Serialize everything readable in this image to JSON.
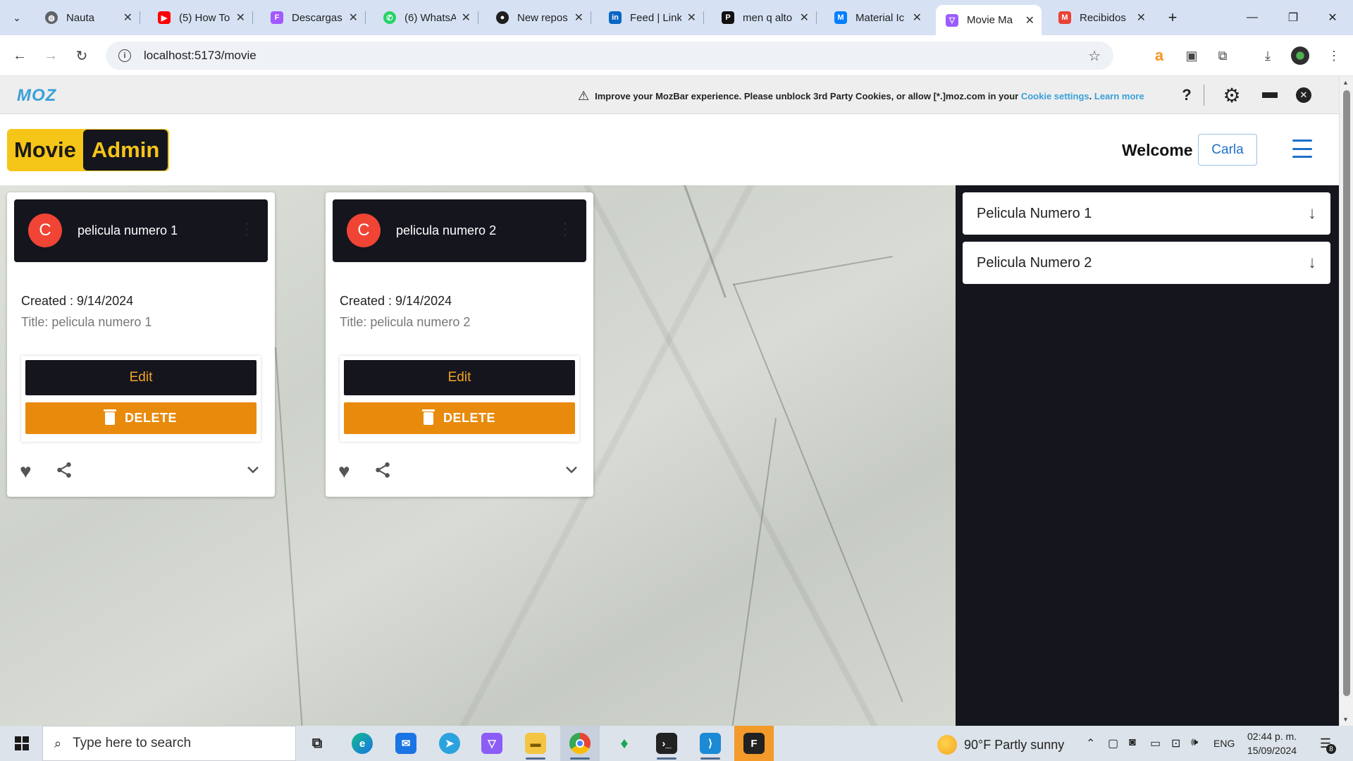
{
  "browser": {
    "tabs": [
      {
        "label": "Nauta",
        "icon": "globe-icon",
        "color": "#5f6368"
      },
      {
        "label": "(5) How To",
        "icon": "youtube-icon",
        "color": "#ff0000"
      },
      {
        "label": "Descargas",
        "icon": "figma-icon",
        "color": "#a259ff"
      },
      {
        "label": "(6) WhatsA",
        "icon": "whatsapp-icon",
        "color": "#25d366"
      },
      {
        "label": "New repos",
        "icon": "github-icon",
        "color": "#1f1f1f"
      },
      {
        "label": "Feed | Link",
        "icon": "linkedin-icon",
        "color": "#0a66c2"
      },
      {
        "label": "men q alto",
        "icon": "p-icon",
        "color": "#111111"
      },
      {
        "label": "Material Ic",
        "icon": "mui-icon",
        "color": "#007fff"
      },
      {
        "label": "Movie Ma",
        "icon": "vite-icon",
        "color": "#9b5cff",
        "active": true
      },
      {
        "label": "Recibidos",
        "icon": "gmail-icon",
        "color": "#ea4335"
      }
    ],
    "url": "localhost:5173/movie"
  },
  "mozbar": {
    "logo": "MOZ",
    "message": "Improve your MozBar experience. Please unblock 3rd Party Cookies, or allow [*.]moz.com in your",
    "cookie_link": "Cookie settings",
    "dot": ".",
    "learn_more": "Learn more",
    "help": "?"
  },
  "header": {
    "logo_part1": "Movie",
    "logo_part2": "Admin",
    "welcome": "Welcome",
    "user": "Carla"
  },
  "cards": [
    {
      "avatar": "C",
      "title": "pelicula numero 1",
      "created": "Created : 9/14/2024",
      "title_line": "Title: pelicula numero 1",
      "edit": "Edit",
      "delete": "DELETE"
    },
    {
      "avatar": "C",
      "title": "pelicula numero 2",
      "created": "Created : 9/14/2024",
      "title_line": "Title: pelicula numero 2",
      "edit": "Edit",
      "delete": "DELETE"
    }
  ],
  "sidebar": {
    "items": [
      {
        "label": "Pelicula Numero 1"
      },
      {
        "label": "Pelicula Numero 2"
      }
    ]
  },
  "taskbar": {
    "search_placeholder": "Type here to search",
    "weather_temp": "90°F",
    "weather_text": "Partly sunny",
    "language": "ENG",
    "time": "02:44 p. m.",
    "date": "15/09/2024",
    "notifications": "8"
  },
  "colors": {
    "brand_yellow": "#f5c518",
    "dark": "#15151e",
    "delete_orange": "#e88a0c",
    "avatar_red": "#f04434",
    "link_blue": "#1e70c9"
  }
}
